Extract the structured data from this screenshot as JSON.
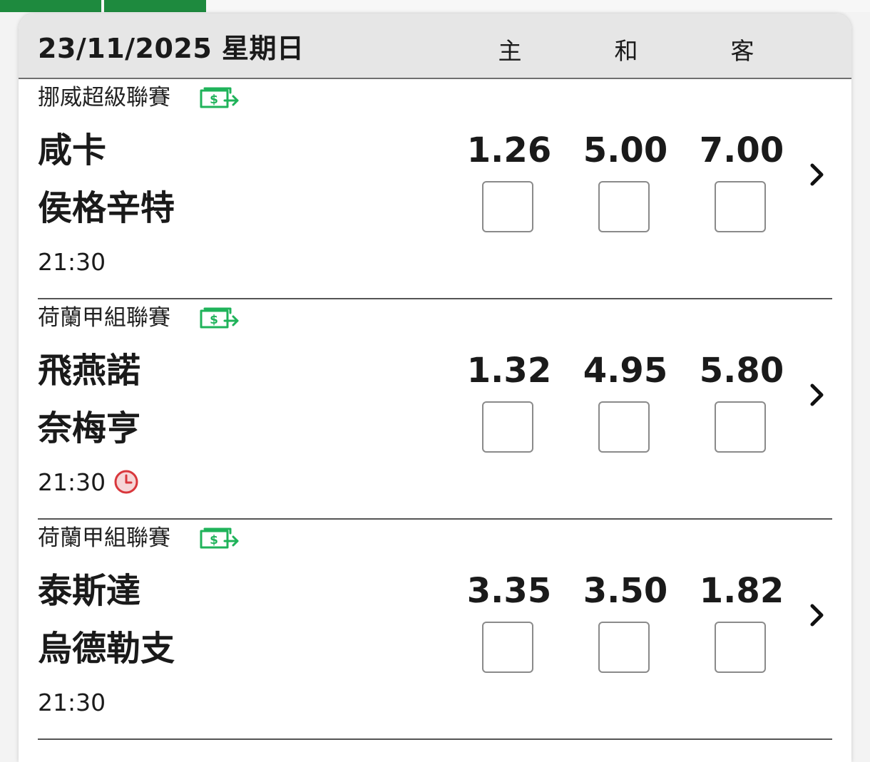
{
  "tabs": [
    "",
    ""
  ],
  "header": {
    "date": "23/11/2025 星期日",
    "col_home": "主",
    "col_draw": "和",
    "col_away": "客"
  },
  "colors": {
    "accent_green": "#1e8a3e",
    "icon_green": "#1fb35a",
    "clock_red": "#d9373c"
  },
  "matches": [
    {
      "league": "挪威超級聯賽",
      "league_icon": "money-transfer-icon",
      "home": "咸卡",
      "away": "侯格辛特",
      "time": "21:30",
      "has_clock": false,
      "odds": {
        "home": "1.26",
        "draw": "5.00",
        "away": "7.00"
      }
    },
    {
      "league": "荷蘭甲組聯賽",
      "league_icon": "money-transfer-icon",
      "home": "飛燕諾",
      "away": "奈梅亨",
      "time": "21:30",
      "has_clock": true,
      "odds": {
        "home": "1.32",
        "draw": "4.95",
        "away": "5.80"
      }
    },
    {
      "league": "荷蘭甲組聯賽",
      "league_icon": "money-transfer-icon",
      "home": "泰斯達",
      "away": "烏德勒支",
      "time": "21:30",
      "has_clock": false,
      "odds": {
        "home": "3.35",
        "draw": "3.50",
        "away": "1.82"
      }
    }
  ]
}
